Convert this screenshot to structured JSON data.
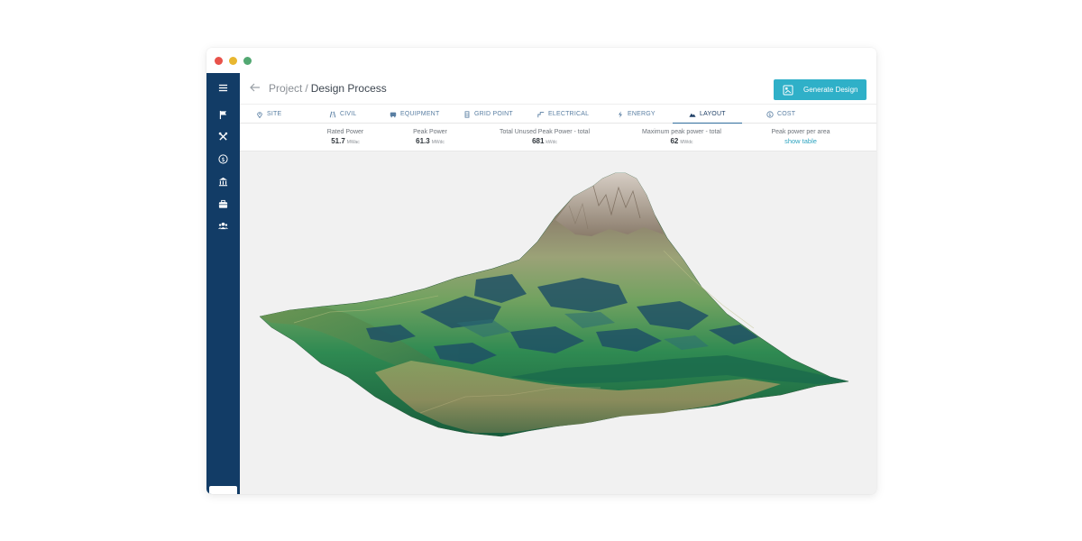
{
  "breadcrumb": {
    "parent": "Project",
    "separator": "/",
    "current": "Design Process"
  },
  "actions": {
    "generate_label": "Generate Design"
  },
  "tabs": [
    {
      "label": "SITE",
      "icon": "location-pin-icon"
    },
    {
      "label": "CIVIL",
      "icon": "road-icon"
    },
    {
      "label": "EQUIPMENT",
      "icon": "equipment-icon"
    },
    {
      "label": "GRID POINT",
      "icon": "grid-point-icon"
    },
    {
      "label": "ELECTRICAL",
      "icon": "electrical-icon"
    },
    {
      "label": "ENERGY",
      "icon": "lightning-icon"
    },
    {
      "label": "LAYOUT",
      "icon": "mountain-icon",
      "active": true
    },
    {
      "label": "COST",
      "icon": "cost-icon"
    }
  ],
  "stats": [
    {
      "label": "Rated Power",
      "value": "51.7",
      "unit": "MWac"
    },
    {
      "label": "Peak Power",
      "value": "61.3",
      "unit": "MWdc"
    },
    {
      "label": "Total Unused Peak Power - total",
      "value": "681",
      "unit": "kWdc"
    },
    {
      "label": "Maximum peak power - total",
      "value": "62",
      "unit": "MWdc"
    },
    {
      "label": "Peak power per area",
      "link": "show table"
    }
  ],
  "sidebar": {
    "items": [
      {
        "icon": "menu-icon"
      },
      {
        "icon": "flag-icon"
      },
      {
        "icon": "tools-icon"
      },
      {
        "icon": "dollar-icon"
      },
      {
        "icon": "bank-icon"
      },
      {
        "icon": "briefcase-icon"
      },
      {
        "icon": "users-icon"
      }
    ],
    "logo": "company-logo"
  },
  "window_controls": {
    "colors": [
      "#e8524a",
      "#e8b730",
      "#52a872"
    ]
  },
  "colors": {
    "sidebar": "#123c66",
    "accent": "#2fb0c8",
    "active_tab": "#1f3f66"
  },
  "viewport": {
    "scene": "3D terrain with solar panel layout"
  }
}
